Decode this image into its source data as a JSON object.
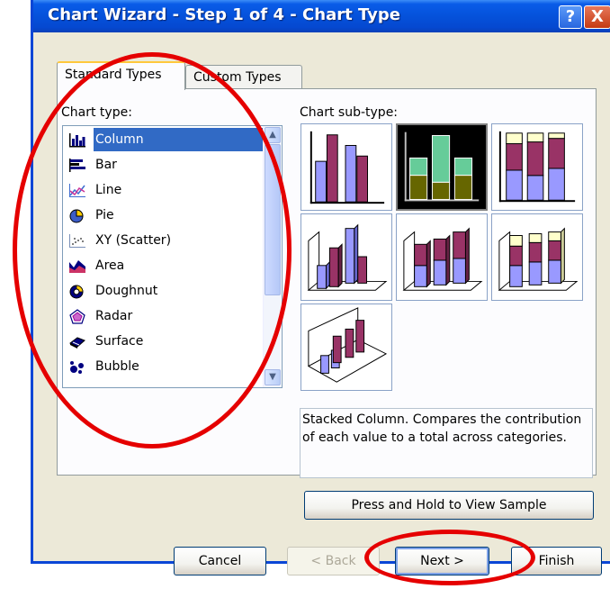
{
  "dialog": {
    "title": "Chart Wizard - Step 1 of 4 - Chart Type",
    "help_glyph": "?",
    "close_glyph": "X"
  },
  "tabs": [
    {
      "label": "Standard Types",
      "active": true
    },
    {
      "label": "Custom Types",
      "active": false
    }
  ],
  "chart_type": {
    "label": "Chart type:",
    "items": [
      {
        "label": "Column",
        "icon": "column-chart-icon",
        "selected": true
      },
      {
        "label": "Bar",
        "icon": "bar-chart-icon"
      },
      {
        "label": "Line",
        "icon": "line-chart-icon"
      },
      {
        "label": "Pie",
        "icon": "pie-chart-icon"
      },
      {
        "label": "XY (Scatter)",
        "icon": "scatter-chart-icon"
      },
      {
        "label": "Area",
        "icon": "area-chart-icon"
      },
      {
        "label": "Doughnut",
        "icon": "doughnut-chart-icon"
      },
      {
        "label": "Radar",
        "icon": "radar-chart-icon"
      },
      {
        "label": "Surface",
        "icon": "surface-chart-icon"
      },
      {
        "label": "Bubble",
        "icon": "bubble-chart-icon"
      }
    ]
  },
  "subtype": {
    "label": "Chart sub-type:",
    "selected_index": 1,
    "items": [
      {
        "name": "clustered-column",
        "icon": "clustered-column-icon"
      },
      {
        "name": "stacked-column",
        "icon": "stacked-column-icon"
      },
      {
        "name": "100-stacked-column",
        "icon": "100-stacked-column-icon"
      },
      {
        "name": "3d-clustered-column",
        "icon": "3d-clustered-column-icon"
      },
      {
        "name": "3d-stacked-column",
        "icon": "3d-stacked-column-icon"
      },
      {
        "name": "3d-100-stacked-column",
        "icon": "3d-100-stacked-column-icon"
      },
      {
        "name": "3d-column",
        "icon": "3d-column-icon"
      }
    ],
    "description": "Stacked Column. Compares the contribution of each value to a total across categories."
  },
  "buttons": {
    "sample": "Press and Hold to View Sample",
    "cancel": "Cancel",
    "back": "< Back",
    "next": "Next >",
    "finish": "Finish"
  },
  "colors": {
    "series1": "#9999ff",
    "series2": "#993366",
    "series3": "#ffffcc",
    "annotation": "#e50000",
    "titlebar": "#0553dc"
  }
}
